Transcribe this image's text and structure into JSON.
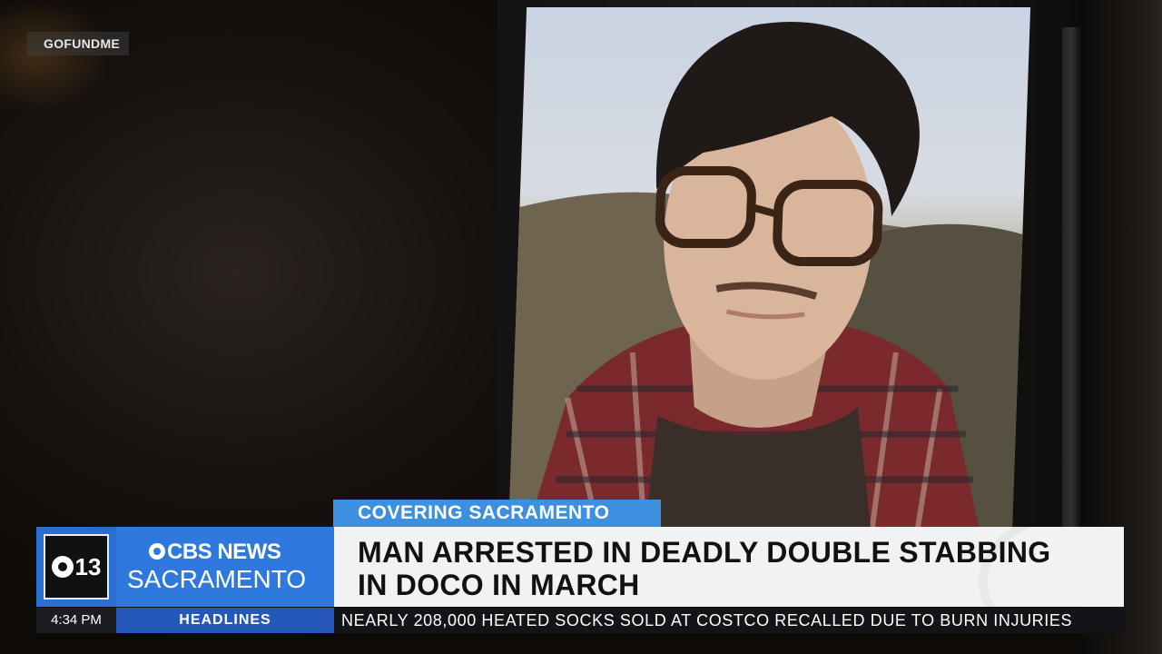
{
  "source_credit": "GOFUNDME",
  "banner": {
    "kicker": "COVERING SACRAMENTO",
    "headline": "MAN ARRESTED IN DEADLY DOUBLE STABBING IN DOCO IN MARCH"
  },
  "station": {
    "channel_number": "13",
    "brand_top": "CBS NEWS",
    "brand_bottom": "SACRAMENTO"
  },
  "ticker": {
    "time": "4:34 PM",
    "label": "HEADLINES",
    "text": "NEARLY 208,000 HEATED SOCKS SOLD AT COSTCO RECALLED DUE TO BURN INJURIES"
  },
  "colors": {
    "kicker_bg": "#3d8fe0",
    "brand_bg": "#2f78dd",
    "headline_bg": "#f1f2f4",
    "ticker_label_bg": "#2558b8"
  }
}
